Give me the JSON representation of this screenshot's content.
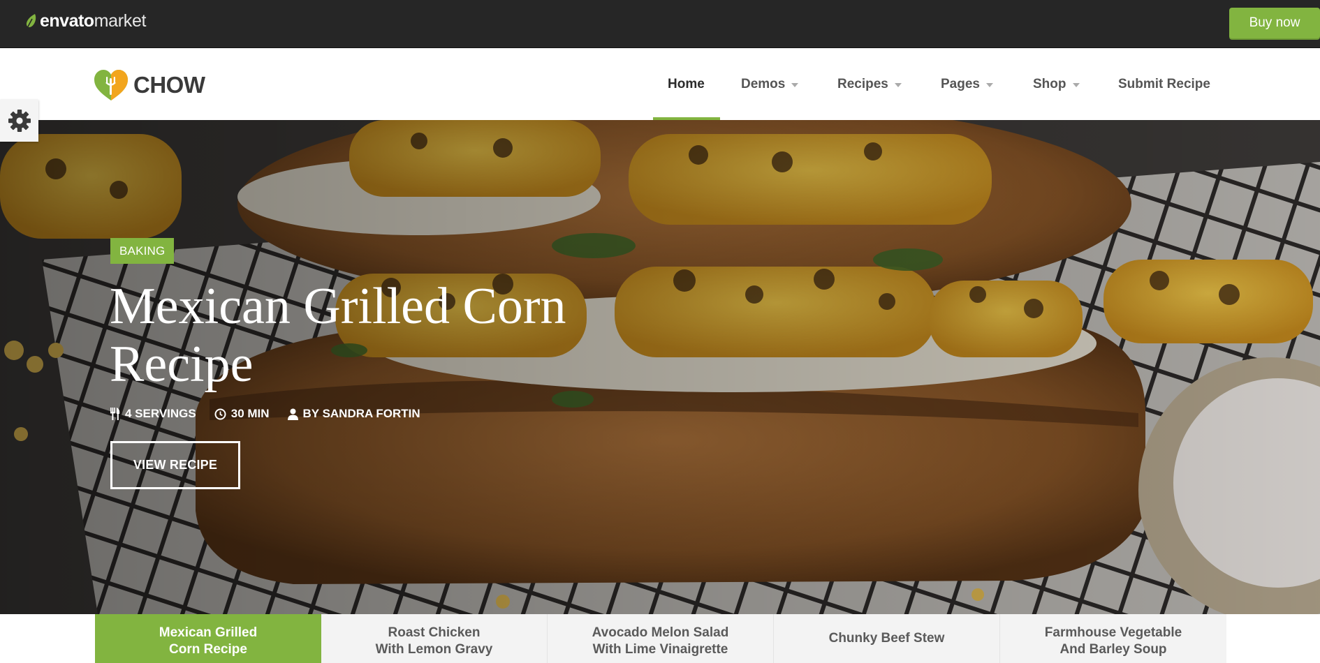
{
  "envato": {
    "brand": "envato",
    "market": "market",
    "buy_now": "Buy now",
    "accent": "#82b440"
  },
  "site": {
    "logo_text": "CHOW",
    "nav": [
      {
        "label": "Home",
        "active": true,
        "dropdown": false
      },
      {
        "label": "Demos",
        "active": false,
        "dropdown": true
      },
      {
        "label": "Recipes",
        "active": false,
        "dropdown": true
      },
      {
        "label": "Pages",
        "active": false,
        "dropdown": true
      },
      {
        "label": "Shop",
        "active": false,
        "dropdown": true
      },
      {
        "label": "Submit Recipe",
        "active": false,
        "dropdown": false
      }
    ]
  },
  "settings": {
    "icon": "gear-icon"
  },
  "hero": {
    "category": "BAKING",
    "title": "Mexican Grilled Corn Recipe",
    "servings": "4 SERVINGS",
    "time": "30 MIN",
    "author": "BY SANDRA FORTIN",
    "cta": "VIEW RECIPE"
  },
  "tabs": [
    {
      "line1": "Mexican Grilled",
      "line2": "Corn Recipe",
      "active": true
    },
    {
      "line1": "Roast Chicken",
      "line2": "With Lemon Gravy",
      "active": false
    },
    {
      "line1": "Avocado Melon Salad",
      "line2": "With Lime Vinaigrette",
      "active": false
    },
    {
      "line1": "Chunky Beef Stew",
      "line2": "",
      "active": false
    },
    {
      "line1": "Farmhouse Vegetable",
      "line2": "And Barley Soup",
      "active": false
    }
  ]
}
